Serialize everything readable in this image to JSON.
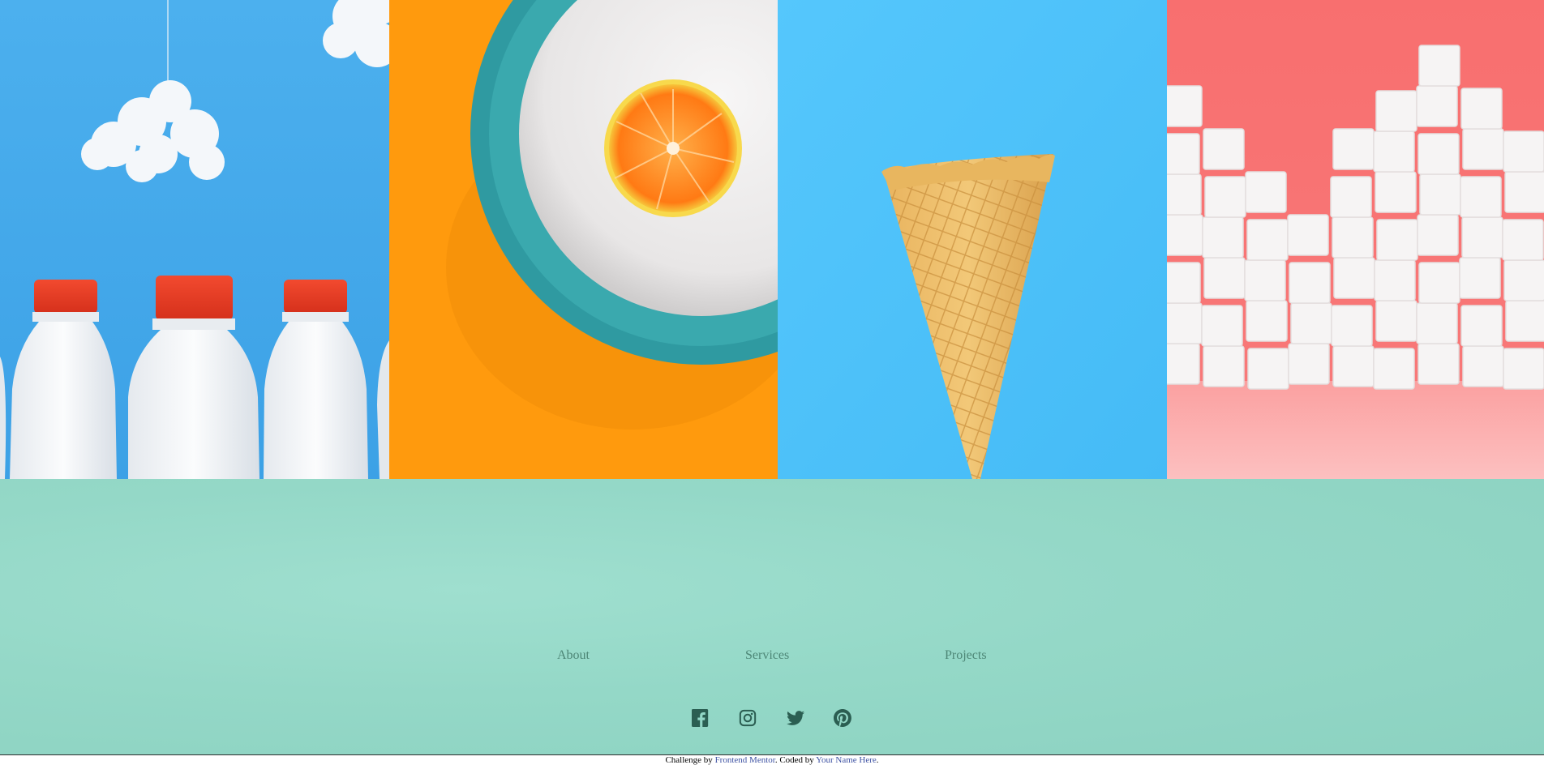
{
  "gallery": {
    "tiles": [
      {
        "name": "milk-bottles-image",
        "bg": "#46a9ec"
      },
      {
        "name": "orange-plate-image",
        "bg": "#ff9a0d"
      },
      {
        "name": "ice-cream-cone-image",
        "bg": "#4fc3fb"
      },
      {
        "name": "sugar-cubes-image",
        "bg": "#f87474"
      }
    ]
  },
  "footer": {
    "bg": "#94d8c7",
    "nav": {
      "about": "About",
      "services": "Services",
      "projects": "Projects"
    },
    "link_color": "#4d8676",
    "icon_color": "#2b5e52",
    "social": [
      {
        "name": "facebook-icon"
      },
      {
        "name": "instagram-icon"
      },
      {
        "name": "twitter-icon"
      },
      {
        "name": "pinterest-icon"
      }
    ]
  },
  "attribution": {
    "prefix": "Challenge by ",
    "challenge_link": "Frontend Mentor",
    "middle": ". Coded by ",
    "author_link": "Your Name Here",
    "suffix": "."
  }
}
